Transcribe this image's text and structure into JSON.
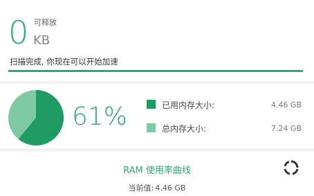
{
  "release": {
    "amount": "0",
    "label": "可释放",
    "unit": "KB",
    "status": "扫描完成, 你现在可以开始加速",
    "progress": 1.0
  },
  "memory": {
    "percent_text": "61%",
    "used_fraction": 0.61,
    "used_label": "已用内存大小:",
    "used_value": "4.46 GB",
    "total_label": "总内存大小:",
    "total_value": "7.24 GB",
    "colors": {
      "used": "#1f9a62",
      "total": "#7fcaa5",
      "accent": "#2eaa74"
    }
  },
  "ram_curve": {
    "title": "RAM 使用率曲线",
    "current_label": "当前值:",
    "current_value": "4.46 GB",
    "refresh_icon": "refresh-icon"
  }
}
